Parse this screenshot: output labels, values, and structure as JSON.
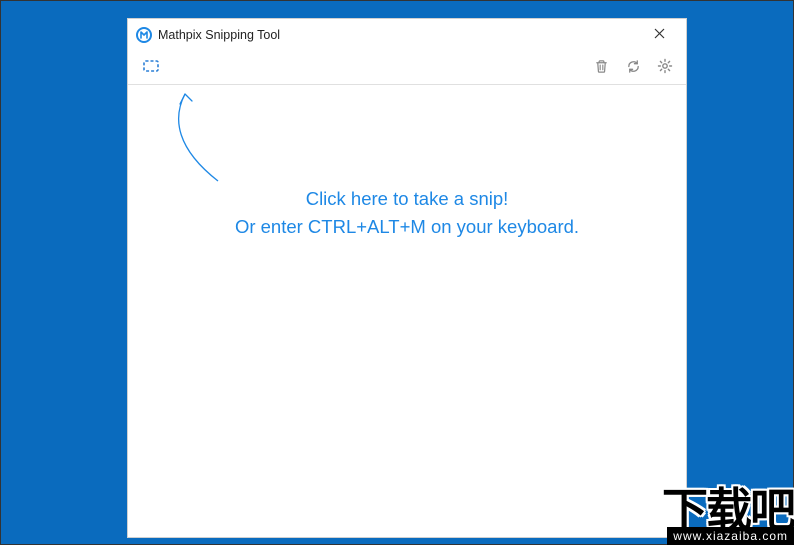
{
  "window": {
    "title": "Mathpix Snipping Tool"
  },
  "toolbar": {
    "snip_icon": "snip-rectangle-icon",
    "delete_icon": "trash-icon",
    "refresh_icon": "refresh-icon",
    "settings_icon": "gear-icon"
  },
  "hint": {
    "line1": "Click here to take a snip!",
    "line2": "Or enter CTRL+ALT+M on your keyboard."
  },
  "watermark": {
    "text": "下载吧",
    "url": "www.xiazaiba.com"
  }
}
